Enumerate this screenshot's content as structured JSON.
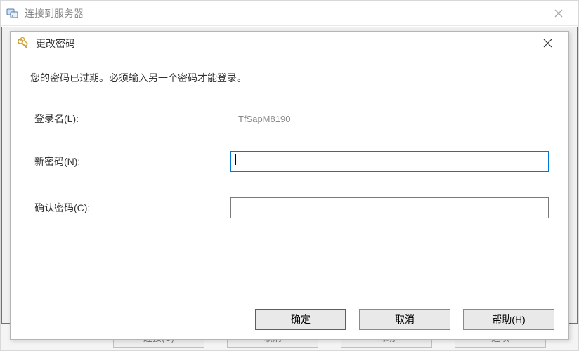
{
  "parent_window": {
    "title": "连接到服务器",
    "bottom_buttons": {
      "connect": "连接(C)",
      "cancel": "取消",
      "help": "帮助",
      "options": "选项"
    }
  },
  "dialog": {
    "title": "更改密码",
    "message": "您的密码已过期。必须输入另一个密码才能登录。",
    "fields": {
      "login": {
        "label": "登录名(L):",
        "value": "TfSapM8190"
      },
      "new_password": {
        "label": "新密码(N):",
        "value": ""
      },
      "confirm_password": {
        "label": "确认密码(C):",
        "value": ""
      }
    },
    "buttons": {
      "ok": "确定",
      "cancel": "取消",
      "help": "帮助(H)"
    }
  },
  "icons": {
    "server": "server-icon",
    "keys": "keys-icon",
    "close": "close-icon"
  }
}
